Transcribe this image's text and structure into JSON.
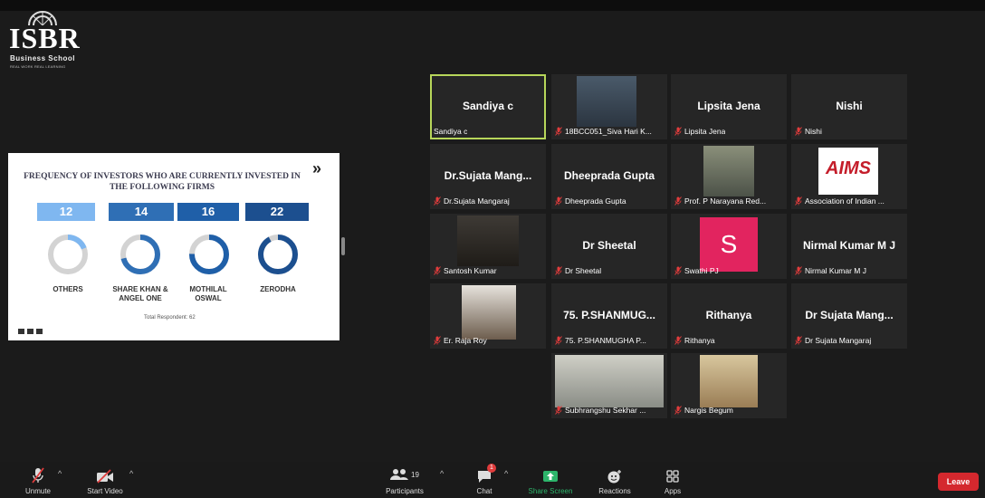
{
  "logo": {
    "name": "ISBR",
    "subtitle": "Business School",
    "tagline": "REAL WORK REAL LEARNING"
  },
  "slide": {
    "title": "FREQUENCY OF INVESTORS WHO ARE CURRENTLY INVESTED IN THE FOLLOWING FIRMS",
    "bars": [
      {
        "value": "12",
        "color": "#7fb7f0"
      },
      {
        "value": "14",
        "color": "#2f6fb5"
      },
      {
        "value": "16",
        "color": "#1f5fa8"
      },
      {
        "value": "22",
        "color": "#1c4f8f"
      }
    ],
    "labels": [
      "OTHERS",
      "SHARE KHAN & ANGEL ONE",
      "MOTHILAL OSWAL",
      "ZERODHA"
    ],
    "total": "Total Respondent: 62"
  },
  "participants": [
    {
      "name": "Sandiya c",
      "label": "Sandiya c",
      "type": "name",
      "active": true
    },
    {
      "name": "",
      "label": "18BCC051_Siva Hari K...",
      "type": "photo"
    },
    {
      "name": "Lipsita Jena",
      "label": "Lipsita Jena",
      "type": "name"
    },
    {
      "name": "Nishi",
      "label": "Nishi",
      "type": "name"
    },
    {
      "name": "Dr.Sujata Mang...",
      "label": "Dr.Sujata Mangaraj",
      "type": "name"
    },
    {
      "name": "Dheeprada Gupta",
      "label": "Dheeprada Gupta",
      "type": "name"
    },
    {
      "name": "",
      "label": "Prof. P Narayana Red...",
      "type": "photo"
    },
    {
      "name": "AIMS",
      "label": "Association of Indian ...",
      "type": "logo"
    },
    {
      "name": "",
      "label": "Santosh Kumar",
      "type": "photo"
    },
    {
      "name": "Dr Sheetal",
      "label": "Dr Sheetal",
      "type": "name"
    },
    {
      "name": "S",
      "label": "Swathi PJ",
      "type": "avatar"
    },
    {
      "name": "Nirmal Kumar M J",
      "label": "Nirmal Kumar M J",
      "type": "name"
    },
    {
      "name": "",
      "label": "Er. Raja Roy",
      "type": "photo"
    },
    {
      "name": "75. P.SHANMUG...",
      "label": "75. P.SHANMUGHA P...",
      "type": "name"
    },
    {
      "name": "Rithanya",
      "label": "Rithanya",
      "type": "name"
    },
    {
      "name": "Dr Sujata Mang...",
      "label": "Dr Sujata Mangaraj",
      "type": "name"
    },
    {
      "name": "",
      "label": "Subhrangshu Sekhar ...",
      "type": "photo"
    },
    {
      "name": "",
      "label": "Nargis Begum",
      "type": "photo"
    }
  ],
  "toolbar": {
    "unmute": "Unmute",
    "start_video": "Start Video",
    "participants": "Participants",
    "participants_count": "19",
    "chat": "Chat",
    "chat_badge": "1",
    "share_screen": "Share Screen",
    "reactions": "Reactions",
    "apps": "Apps",
    "leave": "Leave"
  }
}
